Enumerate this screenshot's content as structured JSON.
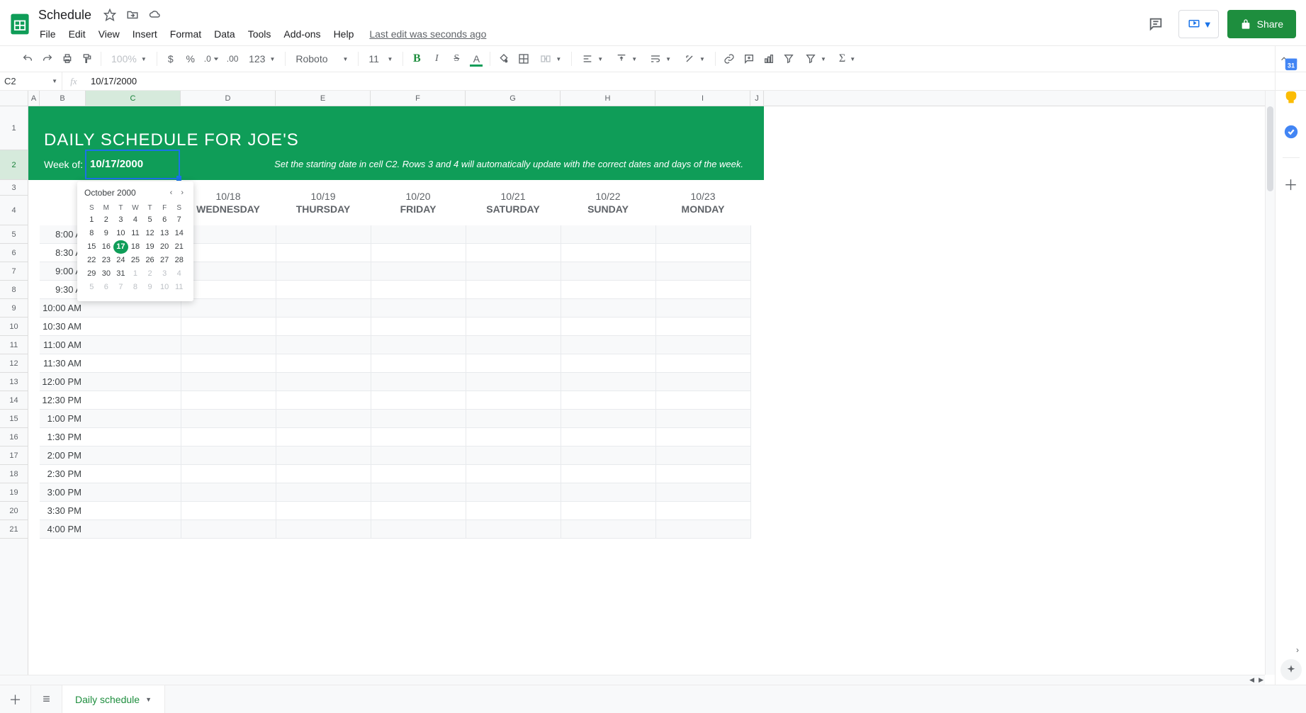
{
  "doc": {
    "title": "Schedule",
    "last_edit": "Last edit was seconds ago"
  },
  "menus": {
    "file": "File",
    "edit": "Edit",
    "view": "View",
    "insert": "Insert",
    "format": "Format",
    "data": "Data",
    "tools": "Tools",
    "addons": "Add-ons",
    "help": "Help"
  },
  "share": {
    "label": "Share"
  },
  "toolbar": {
    "zoom": "100%",
    "currency": "$",
    "percent": "%",
    "dec_dec": ".0",
    "dec_inc": ".00",
    "num_fmt": "123",
    "font": "Roboto",
    "size": "11",
    "bold": "B",
    "italic": "I",
    "strike": "S",
    "color": "A"
  },
  "namebox": "C2",
  "formula": "10/17/2000",
  "columns": [
    "A",
    "B",
    "C",
    "D",
    "E",
    "F",
    "G",
    "H",
    "I",
    "J"
  ],
  "col_widths": [
    "wA",
    "wB",
    "wC",
    "wD",
    "wE",
    "wF",
    "wG",
    "wH",
    "wI",
    "wJ"
  ],
  "row_heights": {
    "r1": 62,
    "r2": 42,
    "r3": 22,
    "r4": 42,
    "default": 26
  },
  "row_count": 21,
  "selected": {
    "col": 2,
    "row": 2
  },
  "banner": {
    "title": "DAILY SCHEDULE FOR JOE'S",
    "weekof_label": "Week of:",
    "weekof_value": "10/17/2000",
    "tip": "Set the starting date in cell C2. Rows 3 and 4 will automatically update with the correct dates and days of the week."
  },
  "days": [
    {
      "date": "10/18",
      "name": "WEDNESDAY"
    },
    {
      "date": "10/19",
      "name": "THURSDAY"
    },
    {
      "date": "10/20",
      "name": "FRIDAY"
    },
    {
      "date": "10/21",
      "name": "SATURDAY"
    },
    {
      "date": "10/22",
      "name": "SUNDAY"
    },
    {
      "date": "10/23",
      "name": "MONDAY"
    }
  ],
  "times": [
    "8:00 A",
    "8:30 A",
    "9:00 A",
    "9:30 A",
    "10:00 AM",
    "10:30 AM",
    "11:00 AM",
    "11:30 AM",
    "12:00 PM",
    "12:30 PM",
    "1:00 PM",
    "1:30 PM",
    "2:00 PM",
    "2:30 PM",
    "3:00 PM",
    "3:30 PM",
    "4:00 PM"
  ],
  "datepicker": {
    "month_label": "October 2000",
    "dow": [
      "S",
      "M",
      "T",
      "W",
      "T",
      "F",
      "S"
    ],
    "weeks": [
      [
        {
          "n": 1
        },
        {
          "n": 2
        },
        {
          "n": 3
        },
        {
          "n": 4
        },
        {
          "n": 5
        },
        {
          "n": 6
        },
        {
          "n": 7
        }
      ],
      [
        {
          "n": 8
        },
        {
          "n": 9
        },
        {
          "n": 10
        },
        {
          "n": 11
        },
        {
          "n": 12
        },
        {
          "n": 13
        },
        {
          "n": 14
        }
      ],
      [
        {
          "n": 15
        },
        {
          "n": 16
        },
        {
          "n": 17,
          "sel": true
        },
        {
          "n": 18
        },
        {
          "n": 19
        },
        {
          "n": 20
        },
        {
          "n": 21
        }
      ],
      [
        {
          "n": 22
        },
        {
          "n": 23
        },
        {
          "n": 24
        },
        {
          "n": 25
        },
        {
          "n": 26
        },
        {
          "n": 27
        },
        {
          "n": 28
        }
      ],
      [
        {
          "n": 29
        },
        {
          "n": 30
        },
        {
          "n": 31
        },
        {
          "n": 1,
          "dim": true
        },
        {
          "n": 2,
          "dim": true
        },
        {
          "n": 3,
          "dim": true
        },
        {
          "n": 4,
          "dim": true
        }
      ],
      [
        {
          "n": 5,
          "dim": true
        },
        {
          "n": 6,
          "dim": true
        },
        {
          "n": 7,
          "dim": true
        },
        {
          "n": 8,
          "dim": true
        },
        {
          "n": 9,
          "dim": true
        },
        {
          "n": 10,
          "dim": true
        },
        {
          "n": 11,
          "dim": true
        }
      ]
    ]
  },
  "sheet_tab": "Daily schedule"
}
